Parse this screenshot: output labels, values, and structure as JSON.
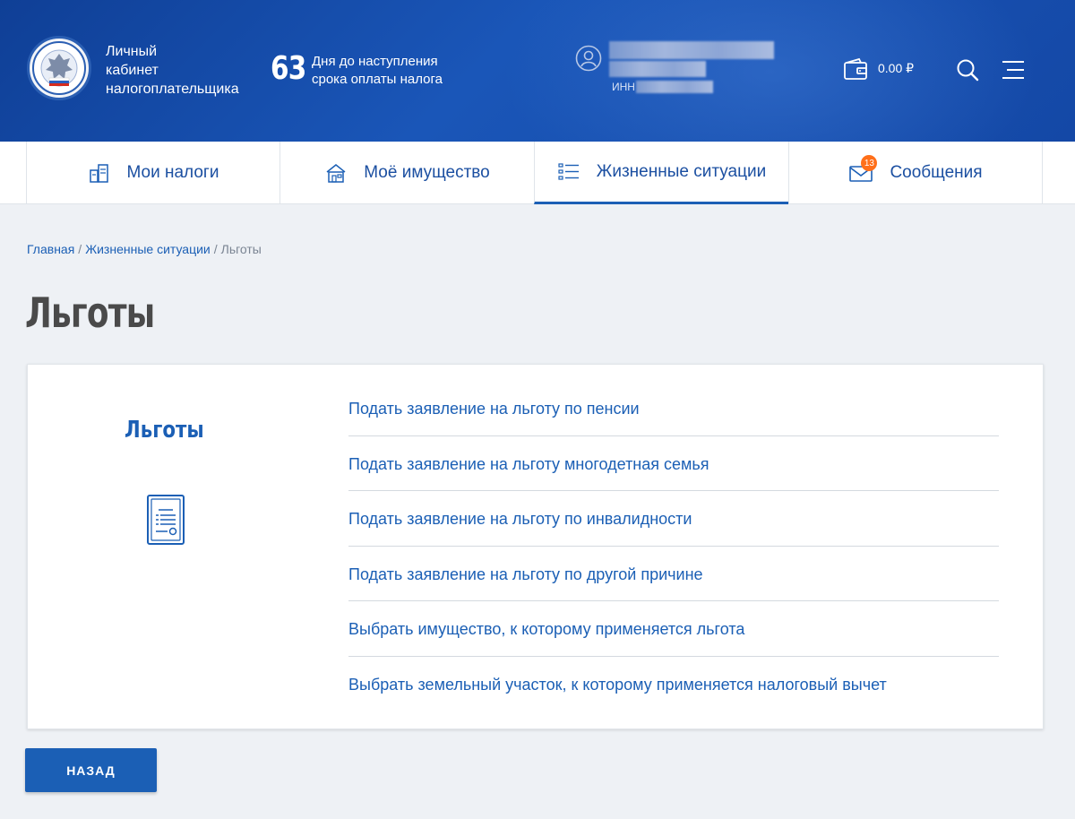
{
  "header": {
    "logo_lines": [
      "Личный",
      "кабинет",
      "налогоплательщика"
    ],
    "emblem_text": "ФЕДЕРАЛЬНАЯ НАЛОГОВАЯ СЛУЖБА",
    "days_number": "63",
    "days_lines": [
      "Дня до наступления",
      "срока оплаты налога"
    ],
    "inn_label": "ИНН",
    "balance": "0.00 ₽"
  },
  "nav": {
    "tabs": [
      {
        "label": "Мои налоги",
        "icon": "taxes-icon",
        "active": false
      },
      {
        "label": "Моё имущество",
        "icon": "property-icon",
        "active": false
      },
      {
        "label": "Жизненные ситуации",
        "icon": "list-icon",
        "active": true
      },
      {
        "label": "Сообщения",
        "icon": "mail-icon",
        "active": false,
        "badge": "13"
      }
    ]
  },
  "breadcrumb": {
    "items": [
      "Главная",
      "Жизненные ситуации",
      "Льготы"
    ],
    "separator": "/"
  },
  "page": {
    "title": "Льготы"
  },
  "card": {
    "title": "Льготы",
    "icon": "certificate-icon",
    "links": [
      "Подать заявление на льготу по пенсии",
      "Подать заявление на льготу многодетная семья",
      "Подать заявление на льготу по инвалидности",
      "Подать заявление на льготу по другой причине",
      "Выбрать имущество, к которому применяется льгота",
      "Выбрать земельный участок, к которому применяется налоговый вычет"
    ]
  },
  "actions": {
    "back_label": "НАЗАД"
  },
  "colors": {
    "header_bg": "#1448a6",
    "accent": "#1b5fb5",
    "badge": "#ff6f1a",
    "page_bg": "#eef1f5"
  }
}
